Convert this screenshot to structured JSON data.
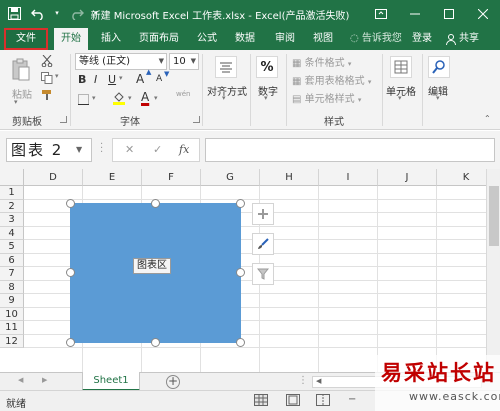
{
  "window": {
    "title": "新建 Microsoft Excel 工作表.xlsx - Excel(产品激活失败)",
    "colors": {
      "brand": "#217346",
      "chart_fill": "#5b9bd5",
      "highlight": "#d9302c"
    }
  },
  "ribbon": {
    "tabs": [
      "文件",
      "开始",
      "插入",
      "页面布局",
      "公式",
      "数据",
      "审阅",
      "视图"
    ],
    "active_tab": "开始",
    "tell_me": "告诉我您",
    "sign_in": "登录",
    "share": "共享",
    "clipboard": {
      "paste": "粘贴",
      "label": "剪贴板"
    },
    "font": {
      "name": "等线 (正文)",
      "size": "10",
      "bold": "B",
      "italic": "I",
      "underline": "U",
      "grow": "A",
      "shrink": "A",
      "wen": "wén",
      "label": "字体"
    },
    "alignment": {
      "label": "对齐方式"
    },
    "number": {
      "label": "数字",
      "symbol": "%"
    },
    "styles": {
      "conditional": "条件格式",
      "table": "套用表格格式",
      "cell": "单元格样式",
      "label": "样式"
    },
    "cells": {
      "label": "单元格"
    },
    "editing": {
      "label": "编辑"
    }
  },
  "formula_bar": {
    "name_box": "图表 2",
    "fx": "fx",
    "cancel": "✕",
    "enter": "✓"
  },
  "grid": {
    "columns": [
      "D",
      "E",
      "F",
      "G",
      "H",
      "I",
      "J",
      "K"
    ],
    "rows": [
      "1",
      "2",
      "3",
      "4",
      "5",
      "6",
      "7",
      "8",
      "9",
      "10",
      "11",
      "12"
    ]
  },
  "chart": {
    "tooltip": "图表区"
  },
  "sheets": {
    "tabs": [
      "Sheet1"
    ]
  },
  "status": {
    "text": "就绪"
  },
  "watermark": {
    "cn": "易采站长站",
    "url": "www.easck.com"
  }
}
